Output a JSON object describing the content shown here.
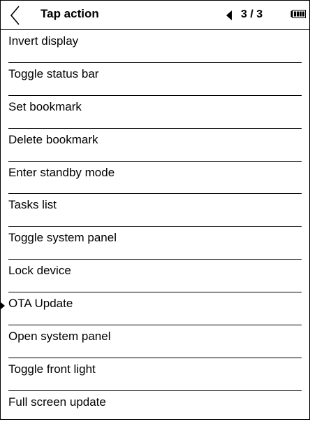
{
  "header": {
    "title": "Tap action",
    "page_indicator": "3 / 3"
  },
  "menu": {
    "items": [
      {
        "label": "Invert display"
      },
      {
        "label": "Toggle status bar"
      },
      {
        "label": "Set bookmark"
      },
      {
        "label": "Delete bookmark"
      },
      {
        "label": "Enter standby mode"
      },
      {
        "label": "Tasks list"
      },
      {
        "label": "Toggle system panel"
      },
      {
        "label": "Lock device"
      },
      {
        "label": "OTA Update",
        "selected": true
      },
      {
        "label": "Open system panel"
      },
      {
        "label": "Toggle front light"
      },
      {
        "label": "Full screen update"
      }
    ]
  },
  "icons": {
    "back": "chevron-left-icon",
    "prev_page": "triangle-left-icon",
    "battery": "battery-icon",
    "selection": "triangle-right-icon"
  }
}
